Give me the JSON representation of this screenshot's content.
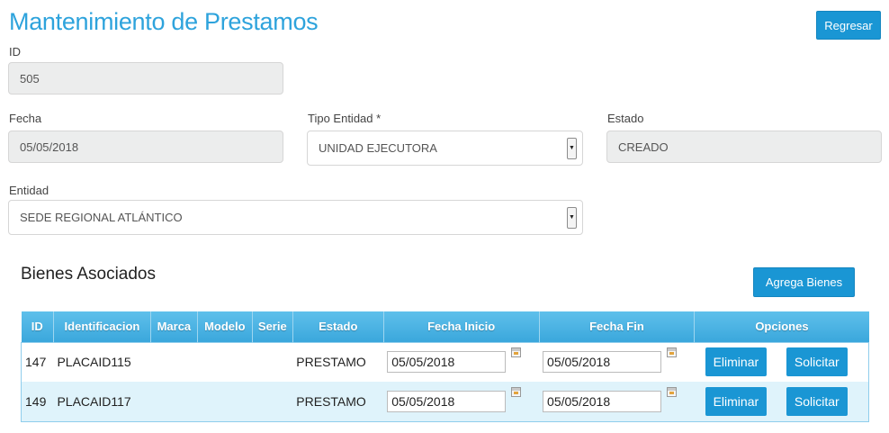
{
  "page": {
    "title": "Mantenimiento de Prestamos",
    "back_label": "Regresar"
  },
  "form": {
    "id_label": "ID",
    "id_value": "505",
    "fecha_label": "Fecha",
    "fecha_value": "05/05/2018",
    "tipo_entidad_label": "Tipo Entidad *",
    "tipo_entidad_value": "UNIDAD EJECUTORA",
    "estado_label": "Estado",
    "estado_value": "CREADO",
    "entidad_label": "Entidad",
    "entidad_value": "SEDE REGIONAL ATLÁNTICO"
  },
  "section": {
    "title": "Bienes Asociados",
    "add_label": "Agrega Bienes"
  },
  "table": {
    "headers": [
      "ID",
      "Identificacion",
      "Marca",
      "Modelo",
      "Serie",
      "Estado",
      "Fecha Inicio",
      "Fecha Fin",
      "Opciones"
    ],
    "rows": [
      {
        "id": "147",
        "identificacion": "PLACAID115",
        "marca": "",
        "modelo": "",
        "serie": "",
        "estado": "PRESTAMO",
        "fecha_inicio": "05/05/2018",
        "fecha_fin": "05/05/2018",
        "eliminar": "Eliminar",
        "solicitar": "Solicitar"
      },
      {
        "id": "149",
        "identificacion": "PLACAID117",
        "marca": "",
        "modelo": "",
        "serie": "",
        "estado": "PRESTAMO",
        "fecha_inicio": "05/05/2018",
        "fecha_fin": "05/05/2018",
        "eliminar": "Eliminar",
        "solicitar": "Solicitar"
      }
    ]
  },
  "colors": {
    "accent": "#1a96d4",
    "title": "#2ea3dc",
    "header": "#3aa7dc",
    "row_alt": "#dff3fb"
  },
  "icons": {
    "calendar": "calendar-icon",
    "select_arrow": "chevron-down-icon"
  }
}
